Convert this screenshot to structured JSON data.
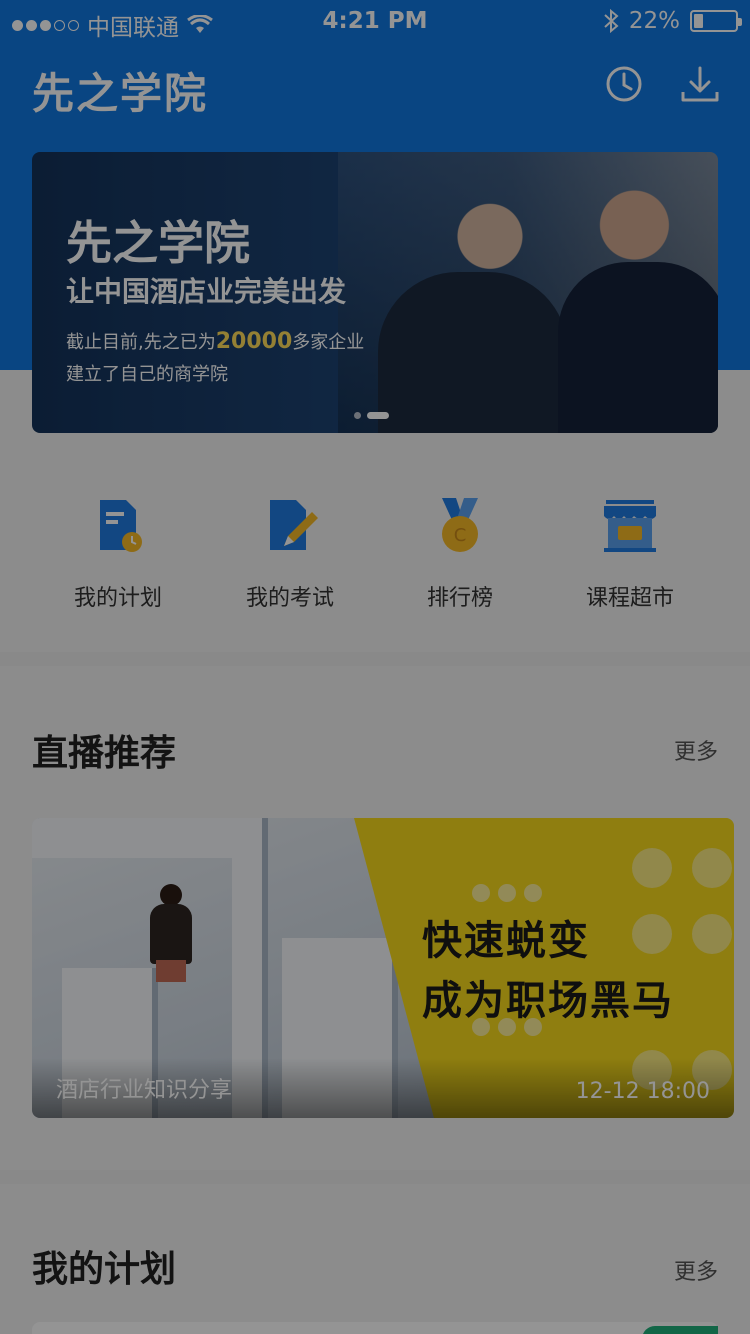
{
  "status_bar": {
    "carrier": "中国联通",
    "time": "4:21 PM",
    "battery_text": "22%",
    "battery_level": 0.22
  },
  "header": {
    "title": "先之学院",
    "icons": [
      "history-clock-icon",
      "download-icon"
    ]
  },
  "banner": {
    "title": "先之学院",
    "subtitle": "让中国酒店业完美出发",
    "desc_prefix": "截止目前,先之已为",
    "desc_number": "20000",
    "desc_suffix": "多家企业",
    "desc_line2": "建立了自己的商学院",
    "page_count": 2,
    "active_page": 1
  },
  "quick_actions": [
    {
      "label": "我的计划",
      "icon": "plan-document-icon"
    },
    {
      "label": "我的考试",
      "icon": "exam-pencil-icon"
    },
    {
      "label": "排行榜",
      "icon": "ranking-medal-icon"
    },
    {
      "label": "课程超市",
      "icon": "course-store-icon"
    }
  ],
  "live_section": {
    "title": "直播推荐",
    "more": "更多",
    "card": {
      "headline_line1": "快速蜕变",
      "headline_line2": "成为职场黑马",
      "caption": "酒店行业知识分享",
      "datetime": "12-12   18:00"
    }
  },
  "plan_section": {
    "title": "我的计划",
    "more": "更多"
  },
  "colors": {
    "brand_blue": "#1177e0",
    "accent_yellow": "#f6da1c",
    "tag_green": "#1fb07a"
  }
}
